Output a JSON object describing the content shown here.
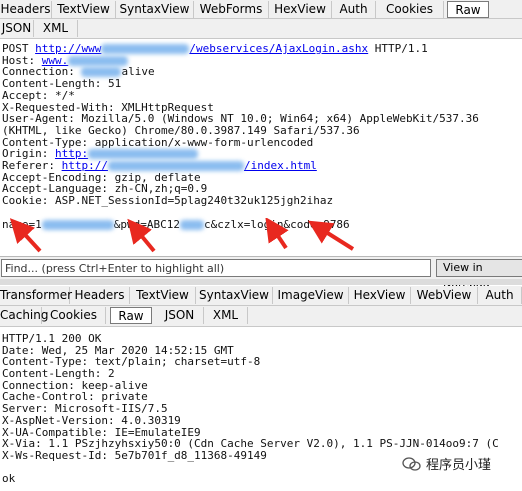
{
  "request_tabs_row1": [
    "Headers",
    "TextView",
    "SyntaxView",
    "WebForms",
    "HexView",
    "Auth",
    "Cookies",
    "Raw"
  ],
  "request_tabs_row2": [
    "JSON",
    "XML"
  ],
  "request": {
    "line1_prefix": "POST ",
    "line1_url_start": "http://www",
    "line1_url_end": "/webservices/AjaxLogin.ashx",
    "line1_suffix": " HTTP/1.1",
    "host_label": "Host: ",
    "host_value": "www.",
    "connection_label": "Connection: ",
    "connection_value": "alive",
    "content_length": "Content-Length: 51",
    "accept": "Accept: */*",
    "xrw": "X-Requested-With: XMLHttpRequest",
    "ua1": "User-Agent: Mozilla/5.0 (Windows NT 10.0; Win64; x64) AppleWebKit/537.36",
    "ua2": "(KHTML, like Gecko) Chrome/80.0.3987.149 Safari/537.36",
    "ctype": "Content-Type: application/x-www-form-urlencoded",
    "origin_label": "Origin: ",
    "origin_value": "http:",
    "referer_label": "Referer: ",
    "referer_start": "http://",
    "referer_end": "/index.html",
    "accept_encoding": "Accept-Encoding: gzip, deflate",
    "accept_language": "Accept-Language: zh-CN,zh;q=0.9",
    "cookie": "Cookie: ASP.NET_SessionId=5plag240t32uk125jgh2ihaz",
    "body_name": "name=1",
    "body_pwd": "&pwd=ABC12",
    "body_rest": "c&czlx=login&code=9786"
  },
  "find": {
    "placeholder": "Find... (press Ctrl+Enter to highlight all)",
    "notepad_button": "View in Notepad"
  },
  "response_tabs_row1": [
    "Transformer",
    "Headers",
    "TextView",
    "SyntaxView",
    "ImageView",
    "HexView",
    "WebView",
    "Auth"
  ],
  "response_tabs_row2": [
    "Caching",
    "Cookies",
    "Raw",
    "JSON",
    "XML"
  ],
  "response_lines": [
    "HTTP/1.1 200 OK",
    "Date: Wed, 25 Mar 2020 14:52:15 GMT",
    "Content-Type: text/plain; charset=utf-8",
    "Content-Length: 2",
    "Connection: keep-alive",
    "Cache-Control: private",
    "Server: Microsoft-IIS/7.5",
    "X-AspNet-Version: 4.0.30319",
    "X-UA-Compatible: IE=EmulateIE9",
    "X-Via: 1.1 PSzjhzyhsxiy50:0 (Cdn Cache Server V2.0), 1.1 PS-JJN-014oo9:7 (C",
    "X-Ws-Request-Id: 5e7b701f_d8_11368-49149",
    "",
    "ok"
  ],
  "watermark": "程序员小瑾",
  "colors": {
    "arrow": "#e8281f",
    "link": "#0000ee"
  }
}
